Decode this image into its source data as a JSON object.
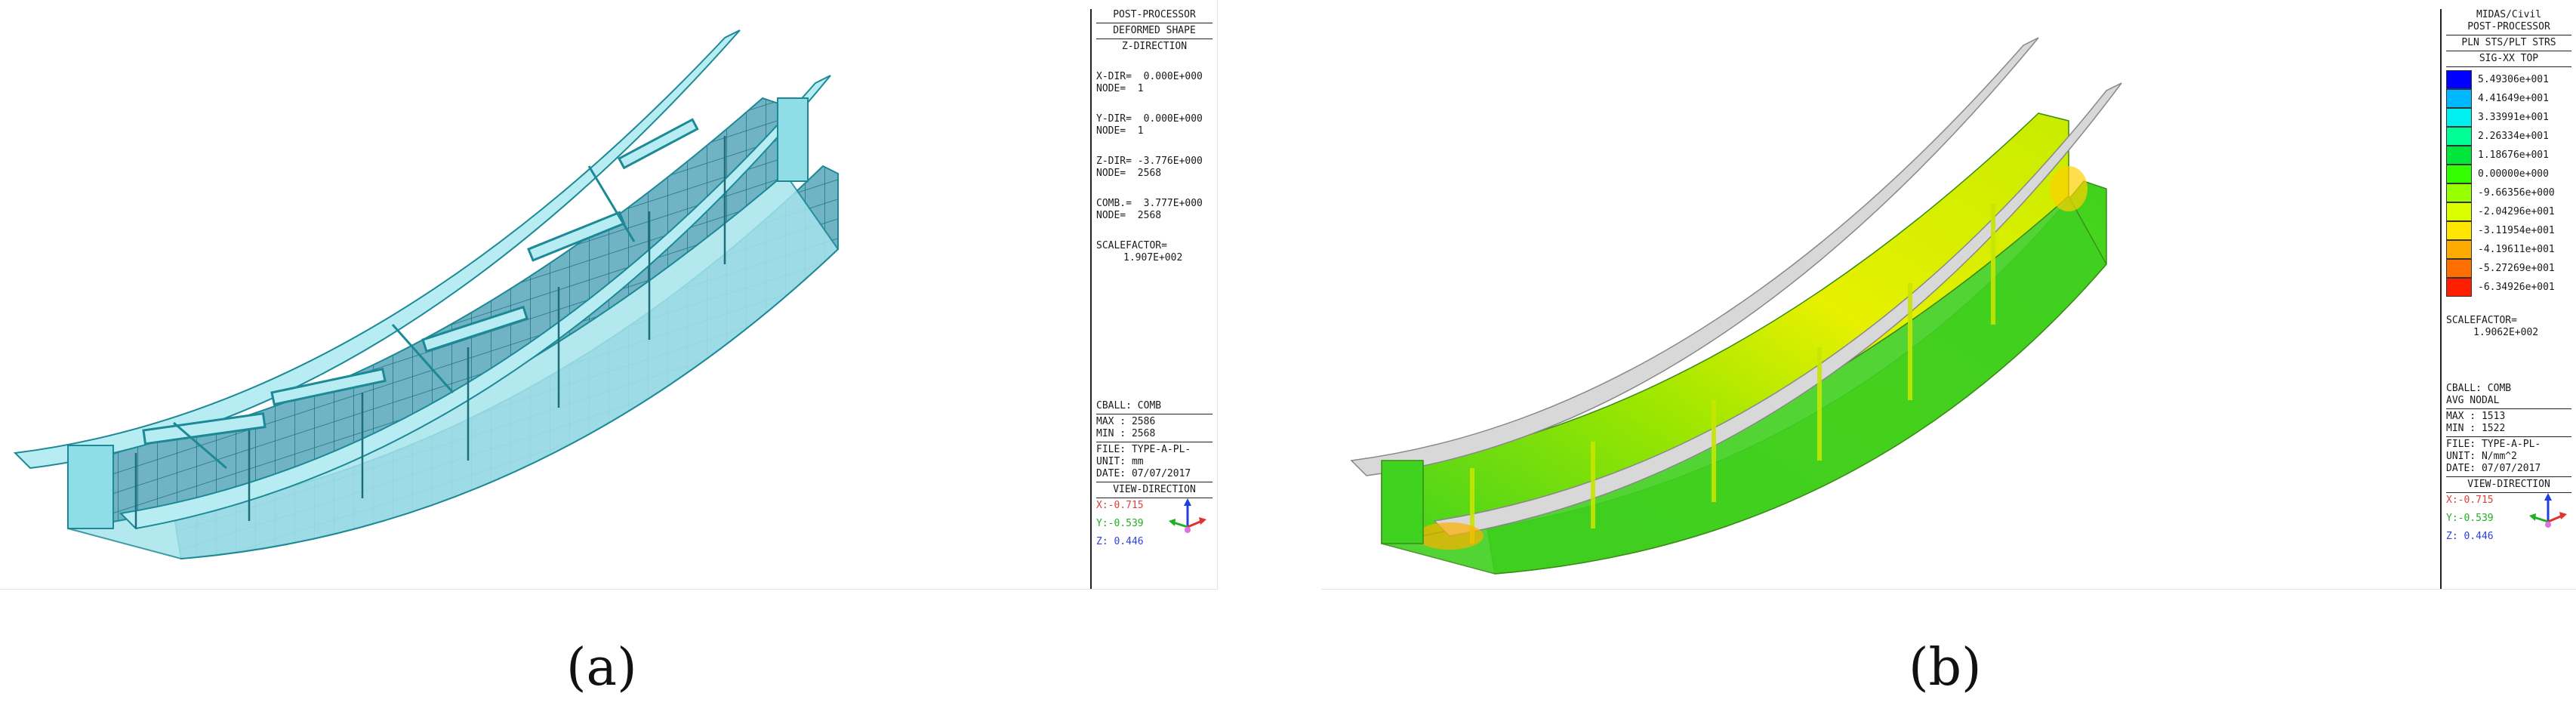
{
  "panel_a": {
    "info": {
      "title_1": "POST-PROCESSOR",
      "title_2": "DEFORMED SHAPE",
      "direction": "Z-DIRECTION",
      "x_dir": "X-DIR=  0.000E+000",
      "x_node": "NODE=  1",
      "y_dir": "Y-DIR=  0.000E+000",
      "y_node": "NODE=  1",
      "z_dir": "Z-DIR= -3.776E+000",
      "z_node": "NODE=  2568",
      "comb": "COMB.=  3.777E+000",
      "comb_node": "NODE=  2568",
      "scalefactor": "SCALEFACTOR=",
      "scalefactor_value": "1.907E+002",
      "cball": "CBALL: COMB",
      "max": "MAX : 2586",
      "min": "MIN : 2568",
      "file": "FILE: TYPE-A-PL-",
      "unit": "UNIT: mm",
      "date": "DATE: 07/07/2017",
      "view_direction": "VIEW-DIRECTION",
      "view_x": "X:-0.715",
      "view_y": "Y:-0.539",
      "view_z": "Z: 0.446"
    }
  },
  "panel_b": {
    "info": {
      "app": "MIDAS/Civil",
      "title_1": "POST-PROCESSOR",
      "title_2": "PLN STS/PLT STRS",
      "component": "SIG-XX TOP",
      "legend": [
        {
          "value": "5.49306e+001",
          "color": "#0000ff"
        },
        {
          "value": "4.41649e+001",
          "color": "#00b8ff"
        },
        {
          "value": "3.33991e+001",
          "color": "#00f0f0"
        },
        {
          "value": "2.26334e+001",
          "color": "#00ff96"
        },
        {
          "value": "1.18676e+001",
          "color": "#00e63c"
        },
        {
          "value": "0.00000e+000",
          "color": "#32ff00"
        },
        {
          "value": "-9.66356e+000",
          "color": "#96ff00"
        },
        {
          "value": "-2.04296e+001",
          "color": "#dcff00"
        },
        {
          "value": "-3.11954e+001",
          "color": "#ffe600"
        },
        {
          "value": "-4.19611e+001",
          "color": "#ffaa00"
        },
        {
          "value": "-5.27269e+001",
          "color": "#ff6e00"
        },
        {
          "value": "-6.34926e+001",
          "color": "#ff1e00"
        }
      ],
      "scalefactor": "SCALEFACTOR=",
      "scalefactor_value": "1.9062E+002",
      "cball": "CBALL: COMB",
      "avg": "AVG NODAL",
      "max": "MAX : 1513",
      "min": "MIN : 1522",
      "file": "FILE: TYPE-A-PL-",
      "unit": "UNIT: N/mm^2",
      "date": "DATE: 07/07/2017",
      "view_direction": "VIEW-DIRECTION",
      "view_x": "X:-0.715",
      "view_y": "Y:-0.539",
      "view_z": "Z: 0.446"
    }
  },
  "captions": {
    "a": "(a)",
    "b": "(b)"
  },
  "colors": {
    "mesh_fill": "#8fdde6",
    "mesh_line": "#1c8a96",
    "stress_green": "#3fd21e",
    "stress_yellow": "#e6f000",
    "view_x": "#e04040",
    "view_y": "#20b020",
    "view_z": "#3040e0"
  }
}
